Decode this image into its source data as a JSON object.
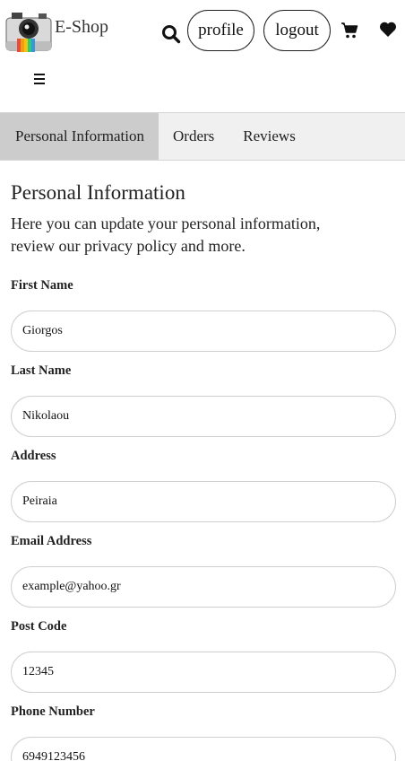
{
  "header": {
    "brand": "E-Shop",
    "profile_label": "profile",
    "logout_label": "logout"
  },
  "tabs": [
    {
      "label": "Personal Information",
      "active": true
    },
    {
      "label": "Orders",
      "active": false
    },
    {
      "label": "Reviews",
      "active": false
    }
  ],
  "main": {
    "title": "Personal Information",
    "intro": "Here you can update your personal information, review our privacy policy and more.",
    "fields": [
      {
        "label": "First Name",
        "value": "Giorgos"
      },
      {
        "label": "Last Name",
        "value": "Nikolaou"
      },
      {
        "label": "Address",
        "value": "Peiraia"
      },
      {
        "label": "Email Address",
        "value": "example@yahoo.gr"
      },
      {
        "label": "Post Code",
        "value": "12345"
      },
      {
        "label": "Phone Number",
        "value": "6949123456"
      }
    ]
  },
  "colors": {
    "active_tab": "#cccccc",
    "tab_bar": "#f0f0f0",
    "input_border": "#cfcfcf"
  }
}
